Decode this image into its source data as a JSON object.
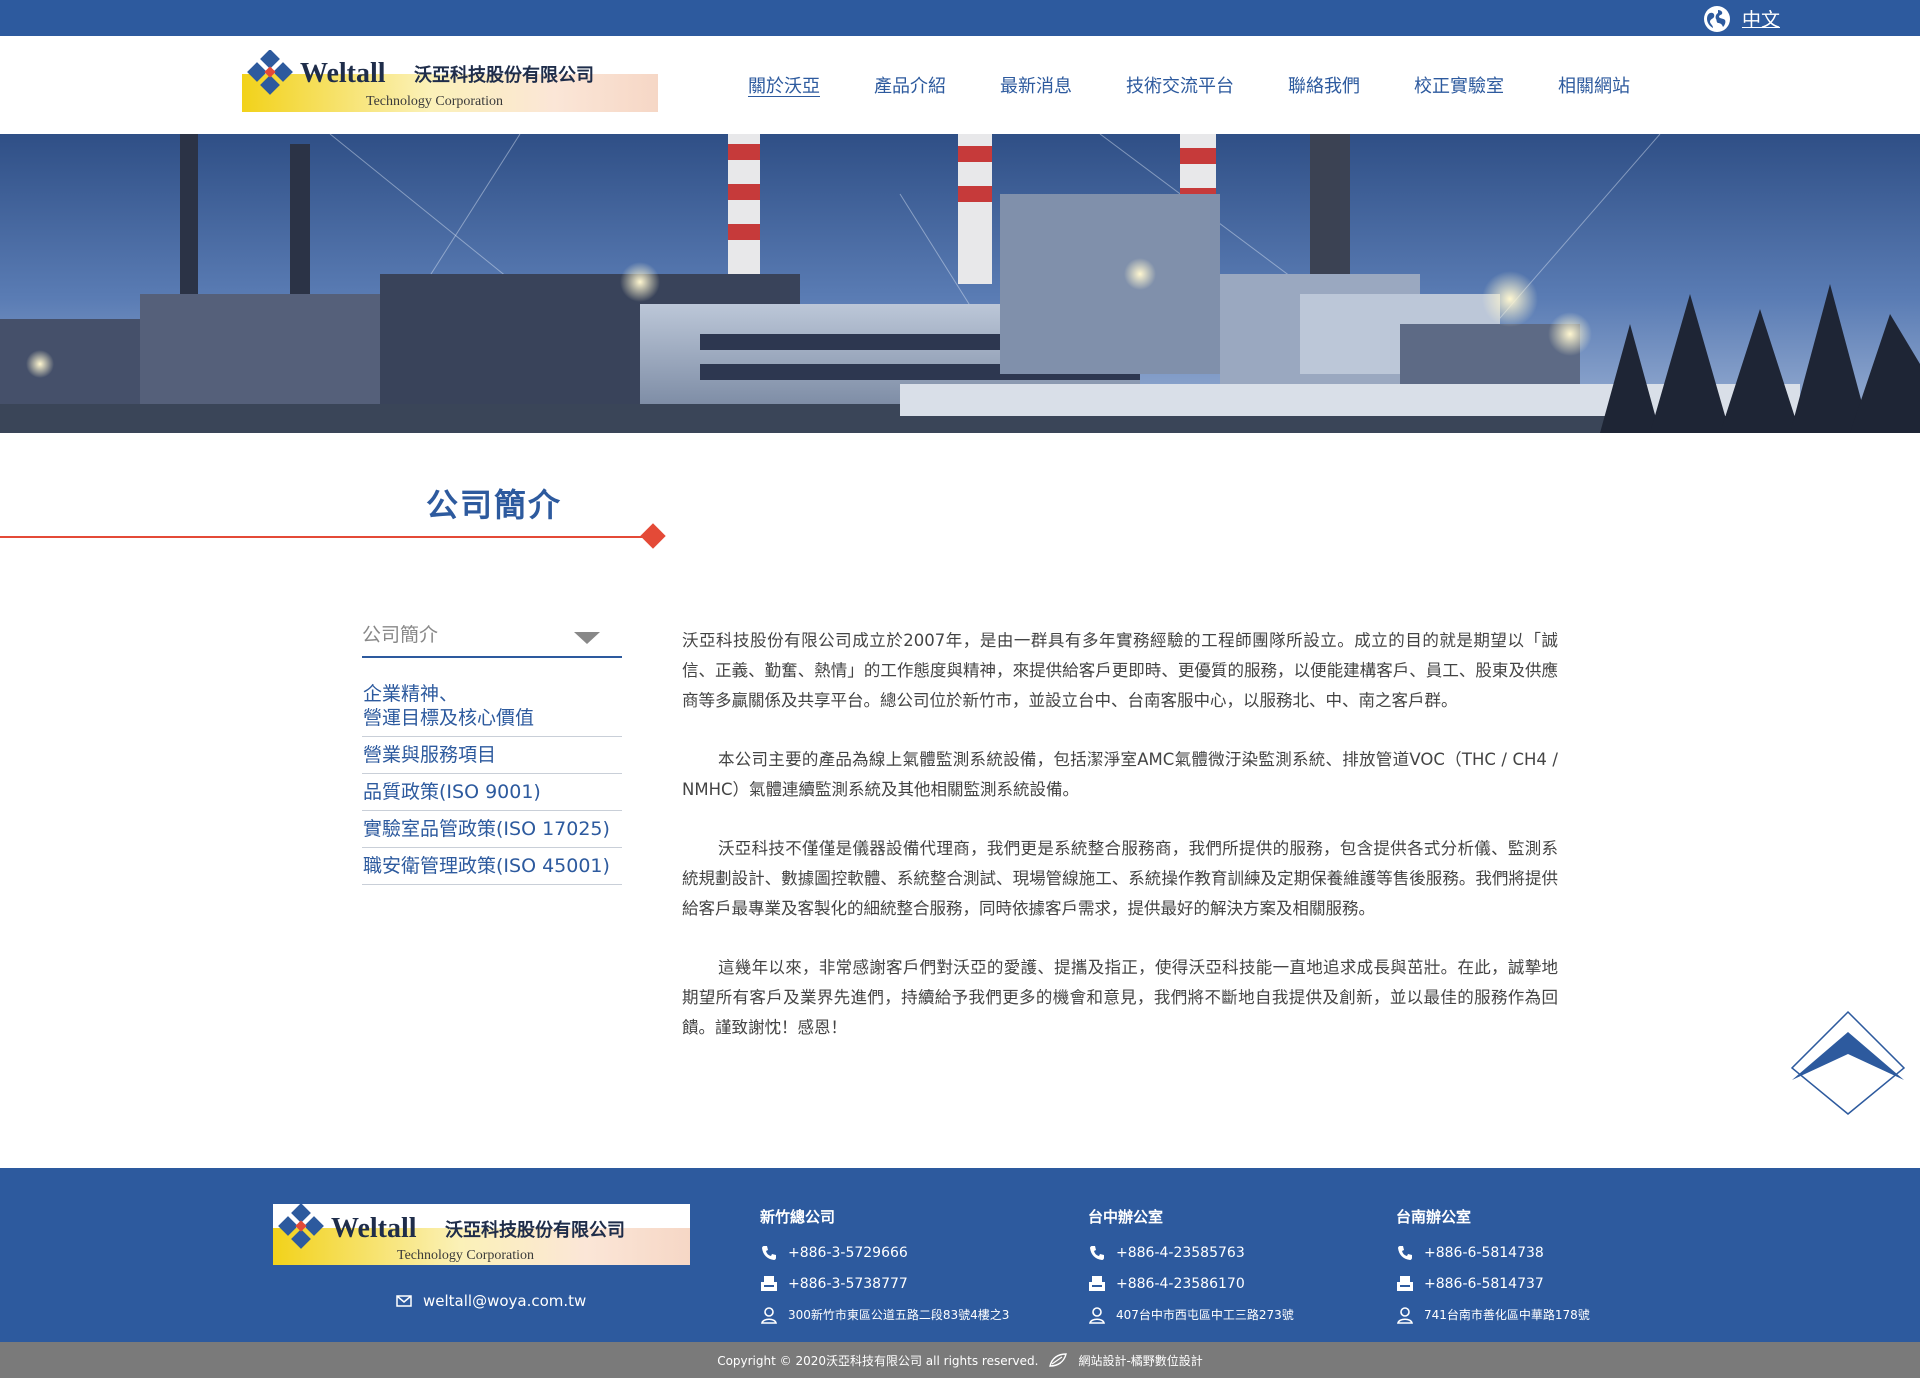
{
  "topbar": {
    "language_label": "中文",
    "globe_icon": "globe-icon"
  },
  "header": {
    "logo": {
      "brand": "Weltall",
      "chinese_name": "沃亞科技股份有限公司",
      "subtitle": "Technology Corporation"
    },
    "nav": [
      {
        "label": "關於沃亞",
        "active": true
      },
      {
        "label": "產品介紹",
        "active": false
      },
      {
        "label": "最新消息",
        "active": false
      },
      {
        "label": "技術交流平台",
        "active": false
      },
      {
        "label": "聯絡我們",
        "active": false
      },
      {
        "label": "校正實驗室",
        "active": false
      },
      {
        "label": "相關網站",
        "active": false
      }
    ]
  },
  "section": {
    "title": "公司簡介",
    "accent_color": "#e44a37"
  },
  "sidebar": {
    "selected": "公司簡介",
    "items": [
      {
        "label": "企業精神、\n營運目標及核心價值"
      },
      {
        "label": "營業與服務項目"
      },
      {
        "label": "品質政策(ISO 9001)"
      },
      {
        "label": "實驗室品管政策(ISO 17025)"
      },
      {
        "label": "職安衛管理政策(ISO 45001)"
      }
    ]
  },
  "article": {
    "paragraphs": [
      "沃亞科技股份有限公司成立於2007年，是由一群具有多年實務經驗的工程師團隊所設立。成立的目的就是期望以「誠信、正義、勤奮、熱情」的工作態度與精神，來提供給客戶更即時、更優質的服務，以便能建構客戶、員工、股東及供應商等多贏關係及共享平台。總公司位於新竹市，並設立台中、台南客服中心，以服務北、中、南之客戶群。",
      "本公司主要的產品為線上氣體監測系統設備，包括潔淨室AMC氣體微汙染監測系統、排放管道VOC（THC / CH4 / NMHC）氣體連續監測系統及其他相關監測系統設備。",
      "沃亞科技不僅僅是儀器設備代理商，我們更是系統整合服務商，我們所提供的服務，包含提供各式分析儀、監測系統規劃設計、數據圖控軟體、系統整合測試、現場管線施工、系統操作教育訓練及定期保養維護等售後服務。我們將提供給客戶最專業及客製化的細統整合服務，同時依據客戶需求，提供最好的解決方案及相關服務。",
      "這幾年以來，非常感謝客戶們對沃亞的愛護、提攜及指正，使得沃亞科技能一直地追求成長與茁壯。在此，誠摯地期望所有客戶及業界先進們，持續給予我們更多的機會和意見，我們將不斷地自我提供及創新，並以最佳的服務作為回饋。謹致謝忱！感恩！"
    ]
  },
  "footer": {
    "logo": {
      "brand": "Weltall",
      "chinese_name": "沃亞科技股份有限公司",
      "subtitle": "Technology Corporation"
    },
    "email": "weltall@woya.com.tw",
    "offices": [
      {
        "name": "新竹總公司",
        "phone": "+886-3-5729666",
        "fax": "+886-3-5738777",
        "address": "300新竹市東區公道五路二段83號4樓之3"
      },
      {
        "name": "台中辦公室",
        "phone": "+886-4-23585763",
        "fax": "+886-4-23586170",
        "address": "407台中市西屯區中工三路273號"
      },
      {
        "name": "台南辦公室",
        "phone": "+886-6-5814738",
        "fax": "+886-6-5814737",
        "address": "741台南市善化區中華路178號"
      }
    ],
    "copyright": "Copyright © 2020沃亞科技有限公司 all rights reserved.",
    "designer": "網站設計-橘野數位設計"
  },
  "colors": {
    "primary": "#2d5a9e",
    "accent": "#e44a37",
    "footer_bottom": "#7a7a7a"
  }
}
